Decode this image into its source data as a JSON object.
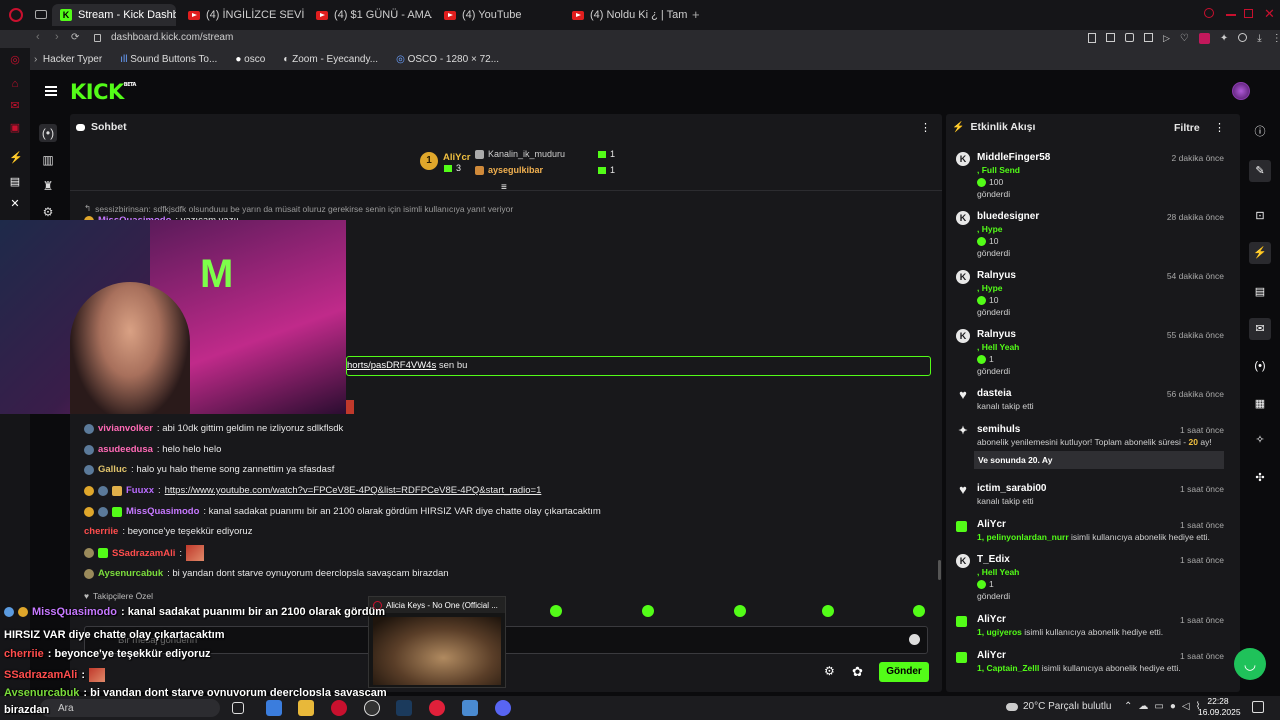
{
  "browser": {
    "tabs": [
      {
        "label": "Stream - Kick Dashboard",
        "active": true
      },
      {
        "label": "(4) İNGİLİZCE SEVİYENİZ"
      },
      {
        "label": "(4) $1 GÜNÜ - AMAZON"
      },
      {
        "label": "(4) YouTube"
      },
      {
        "label": "(4) Noldu Ki ¿ | Tam Çere"
      }
    ],
    "url": "dashboard.kick.com/stream",
    "bookmarks": [
      "Hacker Typer",
      "Sound Buttons To...",
      "osco",
      "Zoom - Eyecandy...",
      "OSCO - 1280 × 72..."
    ]
  },
  "kick": {
    "logo": "KICK",
    "logo_sup": "BETA"
  },
  "chat": {
    "title": "Sohbet",
    "leaderboard": {
      "rank": "1",
      "top_user": "AliYcr",
      "top_count": "3",
      "rows": [
        {
          "user": "Kanalin_ik_muduru",
          "count": "1"
        },
        {
          "user": "aysegulkibar",
          "count": "1"
        }
      ]
    },
    "reply_line": "sessizbirinsan: sdfkjsdfk olsunduuu be yarın da müsait oluruz gerekirse senin için isimli kullanıcıya yanıt veriyor",
    "partial_line": {
      "user": "MissQuasimodo",
      "text": ": yazıcam yazıı"
    },
    "highlight_line": {
      "text_link": "horts/pasDRF4VW4s",
      "text_after": " sen bu"
    },
    "messages": [
      {
        "user": "vivianvolker",
        "color": "#ff6ab6",
        "text": ": abi 10dk gittim geldim ne izliyoruz sdlkflsdk"
      },
      {
        "user": "asudeedusa",
        "color": "#ff6ab6",
        "text": ": helo helo helo"
      },
      {
        "user": "Galluc",
        "color": "#e0c36b",
        "text": ": halo yu halo theme song zannettim ya sfasdasf"
      },
      {
        "user": "Fuuxx",
        "color": "#b96bff",
        "text": ": ",
        "link": "https://www.youtube.com/watch?v=FPCeV8E-4PQ&list=RDFPCeV8E-4PQ&start_radio=1"
      },
      {
        "user": "MissQuasimodo",
        "color": "#c678ff",
        "text": ": kanal sadakat puanımı bir an 2100 olarak gördüm HIRSIZ VAR diye chatte olay çıkartacaktım"
      },
      {
        "user": "cherriie",
        "color": "#ff4d4d",
        "text": ": beyonce'ye teşekkür ediyoruz"
      },
      {
        "user": "SSadrazamAli",
        "color": "#ff4d4d",
        "text": ":"
      },
      {
        "user": "Aysenurcabuk",
        "color": "#7bdc3c",
        "text": ": bi yandan dont starve oynuyorum deerclopsla savaşcam birazdan"
      }
    ],
    "followers_only": "Takipçilere Özel",
    "input_placeholder": "Bir mesaj gönderin",
    "send_label": "Gönder"
  },
  "activity": {
    "title": "Etkinlik Akışı",
    "filter_label": "Filtre",
    "events": [
      {
        "user": "MiddleFinger58",
        "time": "2 dakika önce",
        "l1": ", Full Send",
        "amount": "100",
        "l3": "gönderdi"
      },
      {
        "user": "bluedesigner",
        "time": "28 dakika önce",
        "l1": ", Hype",
        "amount": "10",
        "l3": "gönderdi"
      },
      {
        "user": "Ralnyus",
        "time": "54 dakika önce",
        "l1": ", Hype",
        "amount": "10",
        "l3": "gönderdi"
      },
      {
        "user": "Ralnyus",
        "time": "55 dakika önce",
        "l1": ", Hell Yeah",
        "amount": "1",
        "l3": "gönderdi"
      },
      {
        "user": "dasteia",
        "time": "56 dakika önce",
        "l1": "kanalı takip etti"
      },
      {
        "user": "semihuls",
        "time": "1 saat önce",
        "l1a": "abonelik yenilemesini kutluyor! Toplam abonelik süresi - ",
        "l1b": "20",
        "l1c": " ay!",
        "note": "Ve sonunda 20. Ay"
      },
      {
        "user": "ictim_sarabi00",
        "time": "1 saat önce",
        "l1": "kanalı takip etti"
      },
      {
        "user": "AliYcr",
        "time": "1 saat önce",
        "g1": "1, pelinyonlardan_nurr",
        "g2": " isimli kullanıcıya abonelik hediye etti."
      },
      {
        "user": "T_Edix",
        "time": "1 saat önce",
        "l1": ", Hell Yeah",
        "amount": "1",
        "l3": "gönderdi"
      },
      {
        "user": "AliYcr",
        "time": "1 saat önce",
        "g1": "1, ugiyeros",
        "g2": " isimli kullanıcıya abonelik hediye etti."
      },
      {
        "user": "AliYcr",
        "time": "1 saat önce",
        "g1": "1, Captain_Zelll",
        "g2": " isimli kullanıcıya abonelik hediye etti."
      }
    ]
  },
  "overlay": {
    "lines": [
      {
        "user": "MissQuasimodo",
        "color": "#c678ff",
        "text": " : kanal sadakat puanımı bir an 2100 olarak gördüm"
      },
      {
        "user": "",
        "color": "#fff",
        "text": "HIRSIZ VAR diye chatte olay çıkartacaktım"
      },
      {
        "user": "cherriie",
        "color": "#ff4d4d",
        "text": " : beyonce'ye teşekkür ediyoruz"
      },
      {
        "user": "SSadrazamAli",
        "color": "#ff4d4d",
        "text": " :"
      },
      {
        "user": "Aysenurcabuk",
        "color": "#7bdc3c",
        "text": " : bi yandan dont starve oynuyorum deerclopsla savaşcam"
      },
      {
        "user": "",
        "color": "#fff",
        "text": "birazdan"
      }
    ]
  },
  "mini_player": {
    "title": "Alicia Keys - No One (Official ..."
  },
  "taskbar": {
    "search_label": "Ara",
    "weather": "20°C  Parçalı bulutlu",
    "time": "22:28",
    "date": "16.09.2025"
  },
  "colors": {
    "kick_green": "#53fc18",
    "panel_bg": "#18181b",
    "page_bg": "#0b0b0d"
  }
}
